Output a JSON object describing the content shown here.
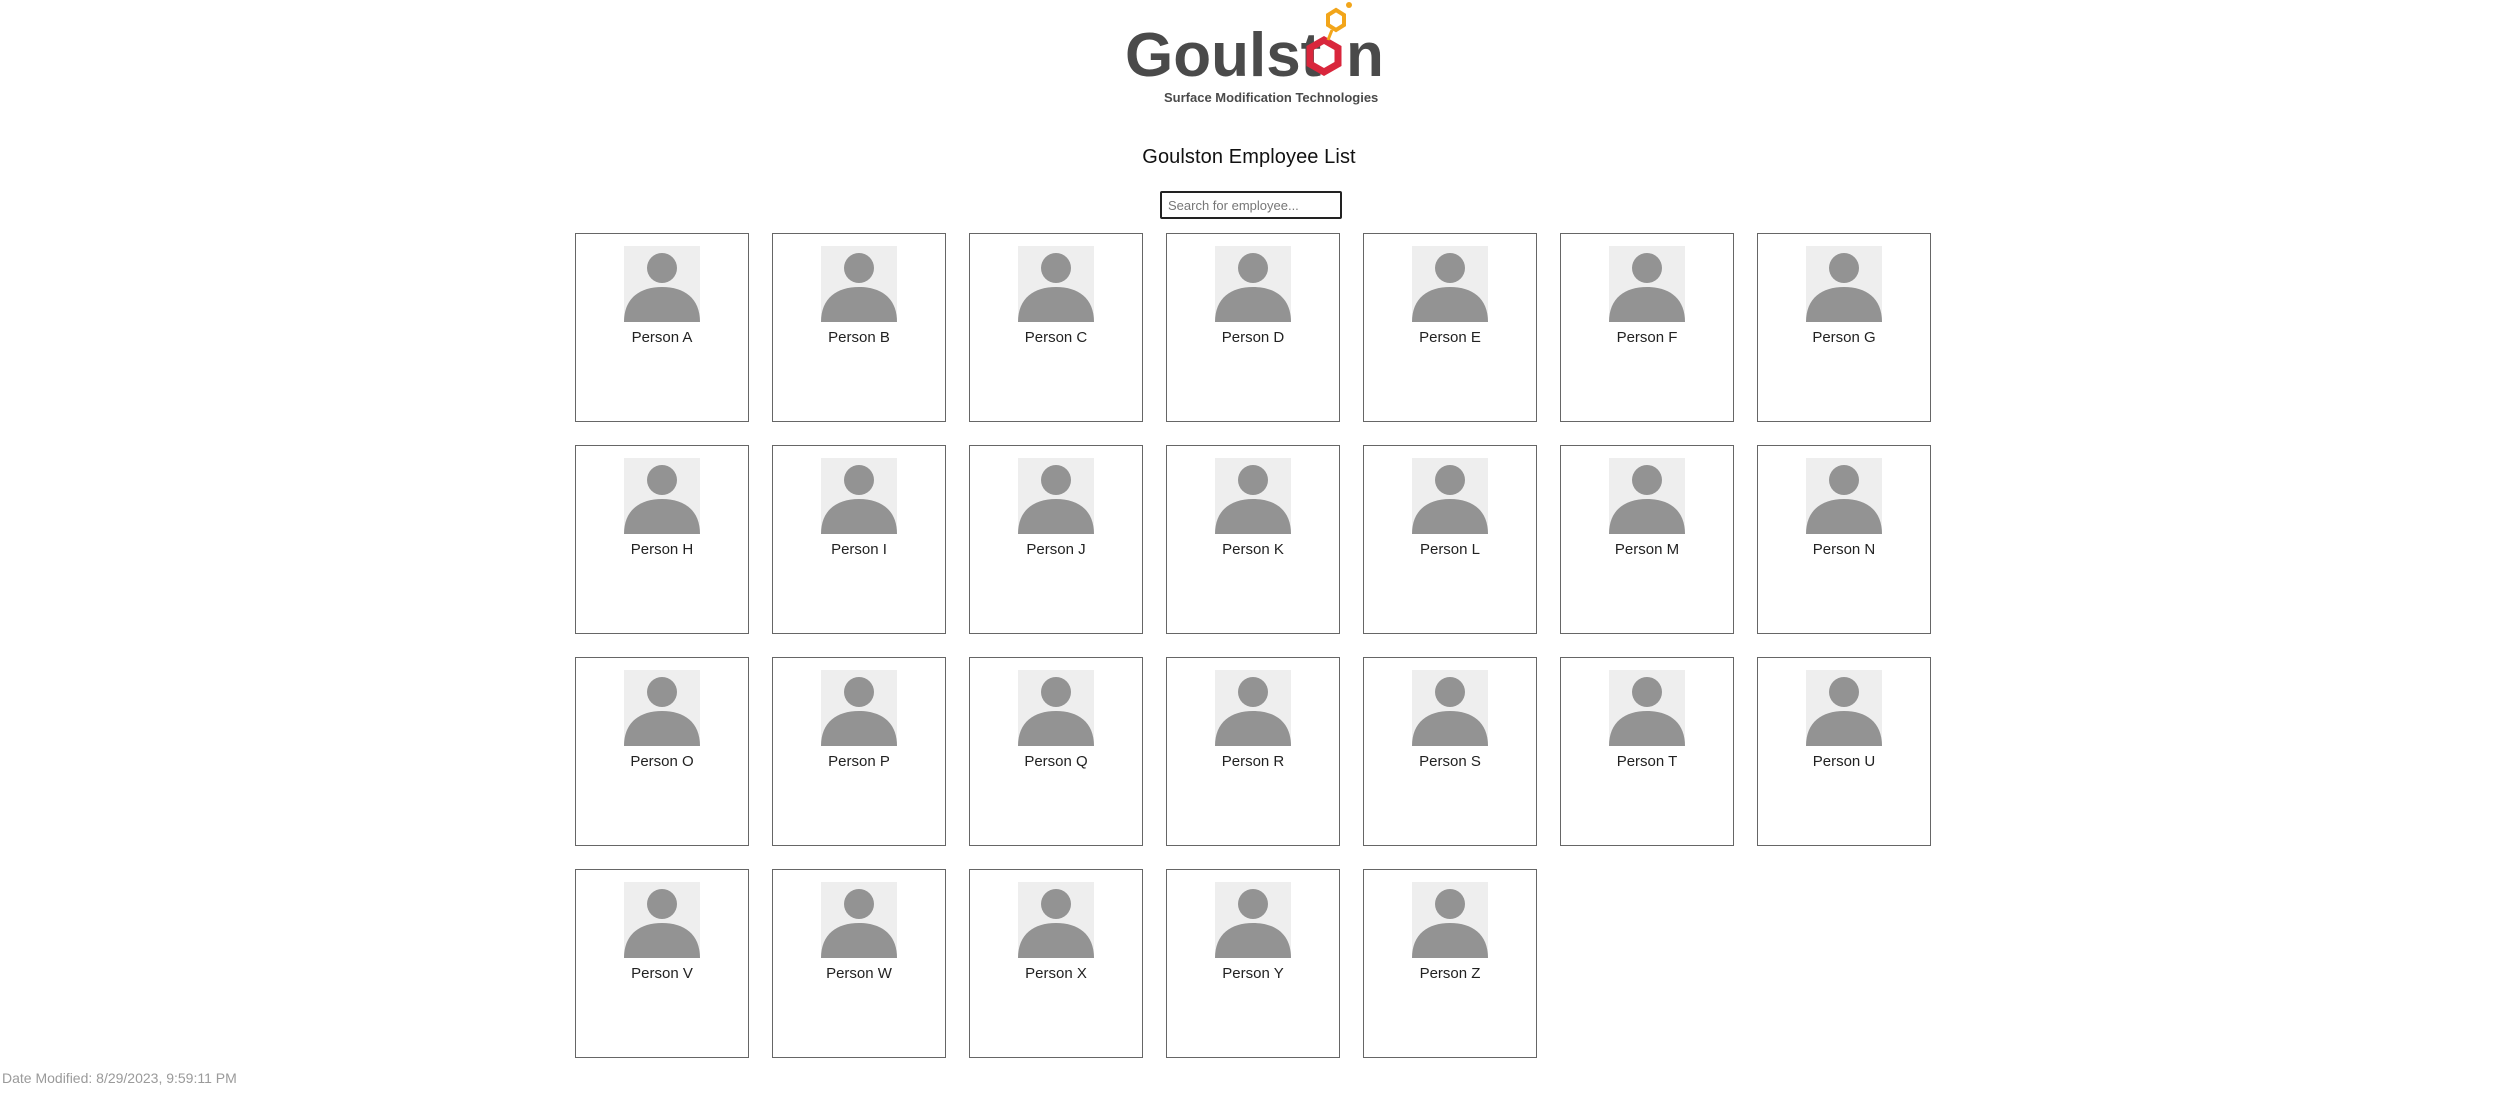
{
  "brand": {
    "wordmark_main": "Goulst",
    "wordmark_end": "n",
    "tagline": "Surface Modification Technologies",
    "colors": {
      "wordmark": "#4a4a4a",
      "hexagon_red": "#d9263c",
      "hexagon_orange": "#f2a51a"
    }
  },
  "page": {
    "title": "Goulston Employee List"
  },
  "search": {
    "placeholder": "Search for employee..."
  },
  "employees": [
    {
      "name": "Person A"
    },
    {
      "name": "Person B"
    },
    {
      "name": "Person C"
    },
    {
      "name": "Person D"
    },
    {
      "name": "Person E"
    },
    {
      "name": "Person F"
    },
    {
      "name": "Person G"
    },
    {
      "name": "Person H"
    },
    {
      "name": "Person I"
    },
    {
      "name": "Person J"
    },
    {
      "name": "Person K"
    },
    {
      "name": "Person L"
    },
    {
      "name": "Person M"
    },
    {
      "name": "Person N"
    },
    {
      "name": "Person O"
    },
    {
      "name": "Person P"
    },
    {
      "name": "Person Q"
    },
    {
      "name": "Person R"
    },
    {
      "name": "Person S"
    },
    {
      "name": "Person T"
    },
    {
      "name": "Person U"
    },
    {
      "name": "Person V"
    },
    {
      "name": "Person W"
    },
    {
      "name": "Person X"
    },
    {
      "name": "Person Y"
    },
    {
      "name": "Person Z"
    }
  ],
  "footer": {
    "date_modified": "Date Modified: 8/29/2023, 9:59:11 PM"
  },
  "icons": {
    "avatar": "person-placeholder-icon"
  }
}
